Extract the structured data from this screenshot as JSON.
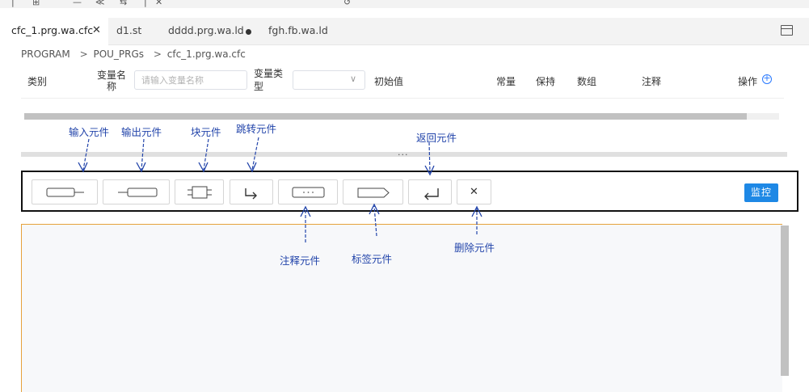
{
  "top_toolbar": {
    "partial_glyphs": [
      "|",
      "⊞",
      "—",
      "≪",
      "⇆",
      "|",
      "✕",
      "↺"
    ]
  },
  "tabs": [
    {
      "label": "cfc_1.prg.wa.cfc",
      "close": "✕",
      "active": true
    },
    {
      "label": "d1.st",
      "active": false
    },
    {
      "label": "dddd.prg.wa.ld",
      "active": false,
      "modified": true
    },
    {
      "label": "fgh.fb.wa.ld",
      "active": false
    }
  ],
  "breadcrumb": [
    "PROGRAM",
    "POU_PRGs",
    "cfc_1.prg.wa.cfc"
  ],
  "breadcrumb_sep": ">",
  "header": {
    "category": "类别",
    "var_name_line1": "变量名",
    "var_name_line2": "称",
    "var_name_placeholder": "请输入变量名称",
    "var_type_line1": "变量类",
    "var_type_line2": "型",
    "select_chevron": "∨",
    "initial_value": "初始值",
    "constant": "常量",
    "retain": "保持",
    "array": "数组",
    "comment": "注释",
    "operation": "操作",
    "add_symbol": "+"
  },
  "splitter_dots": "...",
  "toolbar": {
    "monitor_label": "监控",
    "delete_symbol": "✕"
  },
  "annotations": {
    "input": "输入元件",
    "output": "输出元件",
    "block": "块元件",
    "jump": "跳转元件",
    "return": "返回元件",
    "comment": "注释元件",
    "label": "标签元件",
    "delete": "删除元件"
  },
  "colors": {
    "accent": "#1e88e5",
    "annotation": "#2244aa",
    "canvas_border": "#e6a23c"
  }
}
